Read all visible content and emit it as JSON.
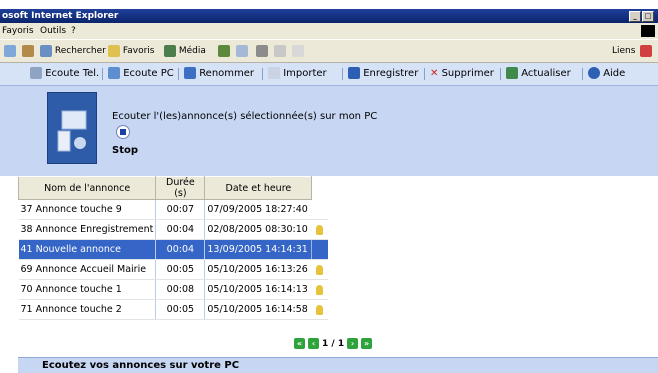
{
  "window": {
    "title": "osoft Internet Explorer"
  },
  "menu": {
    "items": [
      "Fayoris",
      "Outils",
      "?"
    ]
  },
  "ie_toolbar": {
    "search_label": "Rechercher",
    "favorites_label": "Favoris",
    "media_label": "Média",
    "links_label": "Liens"
  },
  "app_toolbar": {
    "buttons": [
      "Ecoute Tel.",
      "Ecoute PC",
      "Renommer",
      "Importer",
      "Enregistrer",
      "Supprimer",
      "Actualiser",
      "Aide"
    ]
  },
  "panel": {
    "message": "Ecouter l'(les)annonce(s) sélectionnée(s) sur mon PC",
    "stop_label": "Stop"
  },
  "table": {
    "columns": [
      "Nom de l'annonce",
      "Durée (s)",
      "Date et heure"
    ],
    "rows": [
      {
        "name": "37 Annonce touche 9",
        "duration": "00:07",
        "date": "07/09/2005 18:27:40",
        "selected": false,
        "bell": false
      },
      {
        "name": "38 Annonce Enregistrement",
        "duration": "00:04",
        "date": "02/08/2005 08:30:10",
        "selected": false,
        "bell": true
      },
      {
        "name": "41 Nouvelle annonce",
        "duration": "00:04",
        "date": "13/09/2005 14:14:31",
        "selected": true,
        "bell": false
      },
      {
        "name": "69 Annonce Accueil Mairie",
        "duration": "00:05",
        "date": "05/10/2005 16:13:26",
        "selected": false,
        "bell": true
      },
      {
        "name": "70 Annonce touche 1",
        "duration": "00:08",
        "date": "05/10/2005 16:14:13",
        "selected": false,
        "bell": true
      },
      {
        "name": "71 Annonce touche 2",
        "duration": "00:05",
        "date": "05/10/2005 16:14:58",
        "selected": false,
        "bell": true
      }
    ]
  },
  "pager": {
    "text": "1 / 1"
  },
  "footer": {
    "text": "Ecoutez vos annonces sur votre PC"
  },
  "colors": {
    "selection": "#3565c6",
    "panel": "#c7d7f3",
    "titlebar": "#0a246a"
  }
}
